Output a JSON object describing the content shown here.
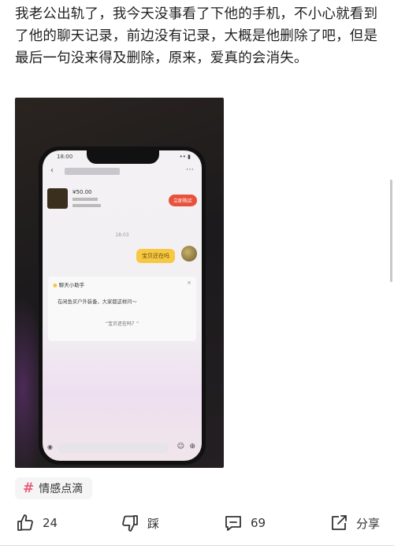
{
  "post": {
    "text": "我老公出轨了，我今天没事看了下他的手机，不小心就看到了他的聊天记录，前边没有记录，大概是他删除了吧，但是最后一句没来得及删除，原来，爱真的会消失。"
  },
  "photo": {
    "status_time": "18:00",
    "status_right": "•• ▮",
    "product_price": "¥50.00",
    "buy_button": "立即购买",
    "chat_time": "18:03",
    "bubble_text": "宝贝还在吗",
    "helper_title": "聊天小助手",
    "helper_close": "×",
    "helper_message": "在闲鱼买户外装备，大家都这样问～",
    "helper_quote": "“宝贝还在吗？”"
  },
  "tag": {
    "label": "情感点滴"
  },
  "actions": {
    "like_count": "24",
    "dislike_label": "踩",
    "comment_count": "69",
    "share_label": "分享"
  },
  "colors": {
    "accent_pink": "#e85c75",
    "bubble_yellow": "#f6c844",
    "buy_red": "#e8513c"
  }
}
